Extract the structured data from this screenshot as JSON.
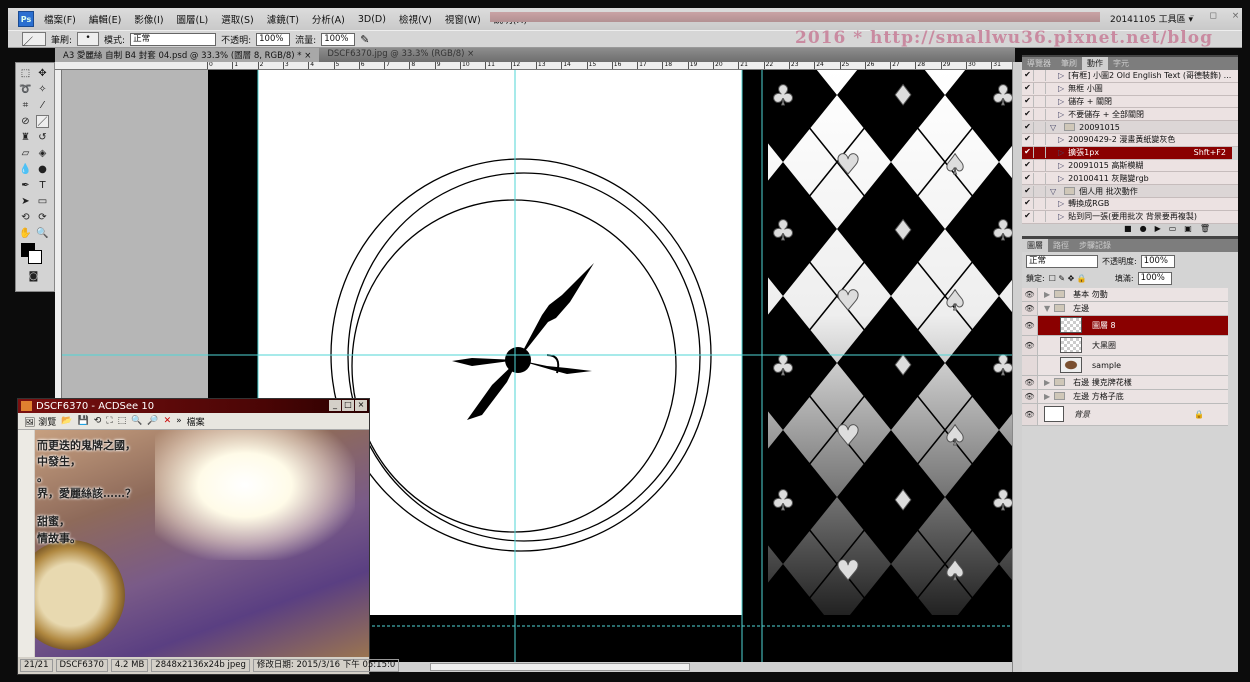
{
  "app": {
    "logo": "Ps",
    "workspace": "20141105 工具區",
    "window_controls": "– ◻ ×"
  },
  "menu": [
    "檔案(F)",
    "編輯(E)",
    "影像(I)",
    "圖層(L)",
    "選取(S)",
    "濾鏡(T)",
    "分析(A)",
    "3D(D)",
    "檢視(V)",
    "視窗(W)",
    "說明(H)"
  ],
  "options": {
    "brush_label": "筆刷:",
    "mode_label": "模式:",
    "mode_value": "正常",
    "opacity_label": "不透明:",
    "opacity_value": "100%",
    "flow_label": "流量:",
    "flow_value": "100%"
  },
  "watermark": "2016 * http://smallwu36.pixnet.net/blog",
  "tabs": [
    {
      "label": "A3 愛麗絲 自制 B4 封套 04.psd @ 33.3% (圖層 8, RGB/8) *",
      "close": "×"
    },
    {
      "label": "DSCF6370.jpg @ 33.3% (RGB/8)",
      "close": "×"
    }
  ],
  "ruler": [
    "0",
    "1",
    "2",
    "3",
    "4",
    "5",
    "6",
    "7",
    "8",
    "9",
    "10",
    "11",
    "12",
    "13",
    "14",
    "15",
    "16",
    "17",
    "18",
    "19",
    "20",
    "21",
    "22",
    "23",
    "24",
    "25",
    "26",
    "27",
    "28",
    "29",
    "30",
    "31"
  ],
  "actions_panel": {
    "tabs": [
      "導覽器",
      "筆刷",
      "動作",
      "字元"
    ],
    "active_tab": "動作",
    "items": [
      {
        "label": "[有框] 小圖2 Old English Text (哥德裝飾) ...",
        "type": "action"
      },
      {
        "label": "無框 小圖",
        "type": "action"
      },
      {
        "label": "儲存 + 關閉",
        "type": "action"
      },
      {
        "label": "不要儲存 + 全部關閉",
        "type": "action"
      },
      {
        "label": "20091015",
        "type": "set"
      },
      {
        "label": "20090429-2 漫畫黃紙變灰色",
        "type": "action"
      },
      {
        "label": "擴張1px",
        "type": "action",
        "shortcut": "Shft+F2",
        "selected": true
      },
      {
        "label": "20091015 高斯模糊",
        "type": "action"
      },
      {
        "label": "20100411 灰階變rgb",
        "type": "action"
      },
      {
        "label": "個人用 批次動作",
        "type": "set"
      },
      {
        "label": "轉換成RGB",
        "type": "action"
      },
      {
        "label": "貼到同一張(要用批次 背景要再複製)",
        "type": "action"
      }
    ]
  },
  "layers_panel": {
    "tabs": [
      "圖層",
      "路徑",
      "步驟記錄"
    ],
    "active_tab": "圖層",
    "blend_mode": "正常",
    "opacity_label": "不透明度:",
    "opacity_value": "100%",
    "lock_label": "鎖定:",
    "fill_label": "填滿:",
    "fill_value": "100%",
    "layers": [
      {
        "name": "基本 勿動",
        "kind": "group",
        "visible": true,
        "expanded": false
      },
      {
        "name": "左邊",
        "kind": "group",
        "visible": true,
        "expanded": true
      },
      {
        "name": "圖層 8",
        "kind": "layer",
        "visible": true,
        "selected": true
      },
      {
        "name": "大黑圈",
        "kind": "layer",
        "visible": true
      },
      {
        "name": "sample",
        "kind": "layer",
        "visible": false
      },
      {
        "name": "右邊 撲克牌花樣",
        "kind": "group",
        "visible": true,
        "expanded": false
      },
      {
        "name": "左邊 方格子底",
        "kind": "group",
        "visible": true,
        "expanded": false
      },
      {
        "name": "背景",
        "kind": "background",
        "visible": true,
        "locked": true
      }
    ]
  },
  "acdsee": {
    "title": "DSCF6370 - ACDSee 10",
    "browse_label": "瀏覽",
    "file_menu": "檔案",
    "photo_text": [
      "而更迭的鬼牌之國，",
      "中發生，",
      "。",
      "界，愛麗絲該……？",
      "甜蜜，",
      "情故事。"
    ],
    "status": {
      "index": "21/21",
      "filename": "DSCF6370",
      "size": "4.2 MB",
      "dimensions": "2848x2136x24b jpeg",
      "modified": "修改日期: 2015/3/16 下午 05:15:0"
    }
  },
  "colors": {
    "selection": "#8a0000",
    "guide": "#4fd6d6",
    "watermark": "#c98aa0"
  }
}
